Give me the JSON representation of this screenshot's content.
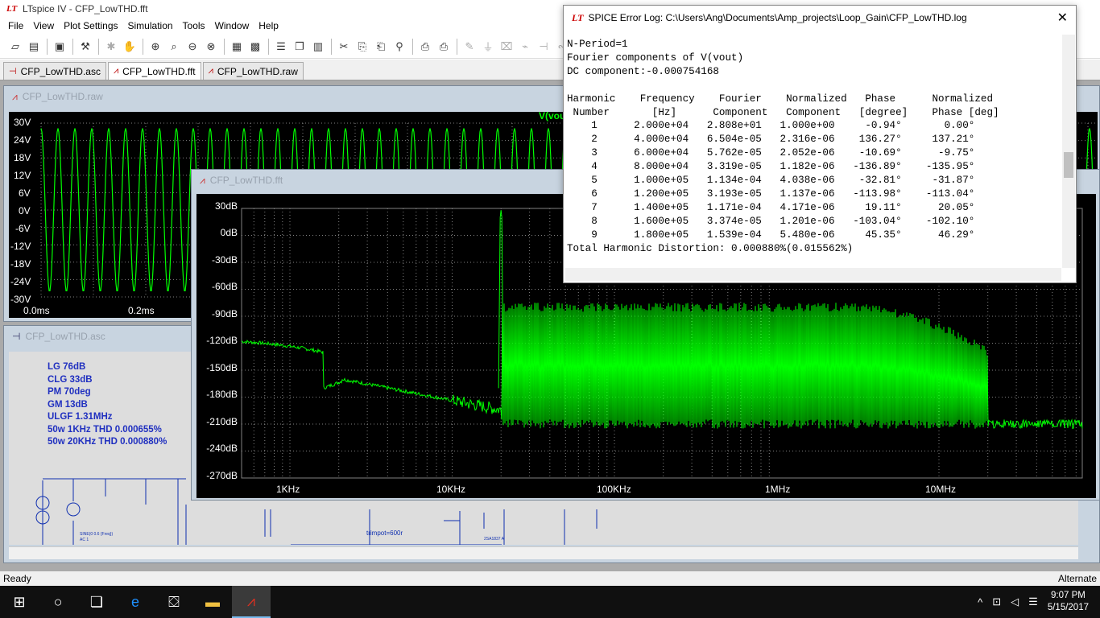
{
  "app": {
    "title": "LTspice IV - CFP_LowTHD.fft"
  },
  "menu": [
    "File",
    "View",
    "Plot Settings",
    "Simulation",
    "Tools",
    "Window",
    "Help"
  ],
  "tabs": [
    {
      "label": "CFP_LowTHD.asc",
      "active": false
    },
    {
      "label": "CFP_LowTHD.fft",
      "active": true
    },
    {
      "label": "CFP_LowTHD.raw",
      "active": false
    }
  ],
  "raw_window": {
    "title": "CFP_LowTHD.raw",
    "trace_label": "V(vout)",
    "y_ticks": [
      "30V",
      "24V",
      "18V",
      "12V",
      "6V",
      "0V",
      "-6V",
      "-12V",
      "-18V",
      "-24V",
      "-30V"
    ],
    "x_ticks": [
      "0.0ms",
      "0.2ms"
    ]
  },
  "fft_window": {
    "title": "CFP_LowTHD.fft",
    "y_ticks": [
      "30dB",
      "0dB",
      "-30dB",
      "-60dB",
      "-90dB",
      "-120dB",
      "-150dB",
      "-180dB",
      "-210dB",
      "-240dB",
      "-270dB"
    ],
    "x_ticks": [
      "1KHz",
      "10KHz",
      "100KHz",
      "1MHz",
      "10MHz"
    ]
  },
  "asc_window": {
    "title": "CFP_LowTHD.asc",
    "notes": [
      "LG 76dB",
      "CLG 33dB",
      "PM 70deg",
      "GM 13dB",
      "ULGF 1.31MHz",
      "50w 1KHz THD 0.000655%",
      "50w  20KHz THD 0.000880%"
    ],
    "schematic_labels": [
      "trimpot=600r",
      "SINE(0 0.6 {Freq})",
      "AC 1",
      "2SA1837 A",
      "Q12"
    ]
  },
  "error_log": {
    "title": "SPICE Error Log: C:\\Users\\Ang\\Documents\\Amp_projects\\Loop_Gain\\CFP_LowTHD.log",
    "lines": [
      "N-Period=1",
      "Fourier components of V(vout)",
      "DC component:-0.000754168",
      "",
      "Harmonic    Frequency    Fourier    Normalized   Phase      Normalized",
      " Number       [Hz]      Component   Component   [degree]    Phase [deg]",
      "    1      2.000e+04   2.808e+01   1.000e+00     -0.94°       0.00°",
      "    2      4.000e+04   6.504e-05   2.316e-06    136.27°     137.21°",
      "    3      6.000e+04   5.762e-05   2.052e-06    -10.69°      -9.75°",
      "    4      8.000e+04   3.319e-05   1.182e-06   -136.89°    -135.95°",
      "    5      1.000e+05   1.134e-04   4.038e-06    -32.81°     -31.87°",
      "    6      1.200e+05   3.193e-05   1.137e-06   -113.98°    -113.04°",
      "    7      1.400e+05   1.171e-04   4.171e-06     19.11°      20.05°",
      "    8      1.600e+05   3.374e-05   1.201e-06   -103.04°    -102.10°",
      "    9      1.800e+05   1.539e-04   5.480e-06     45.35°      46.29°",
      "Total Harmonic Distortion: 0.000880%(0.015562%)"
    ]
  },
  "status": {
    "left": "Ready",
    "right": "Alternate"
  },
  "taskbar": {
    "time": "9:07 PM",
    "date": "5/15/2017"
  },
  "colors": {
    "trace": "#00ff00",
    "plot_bg": "#000000",
    "grid": "#808080"
  }
}
